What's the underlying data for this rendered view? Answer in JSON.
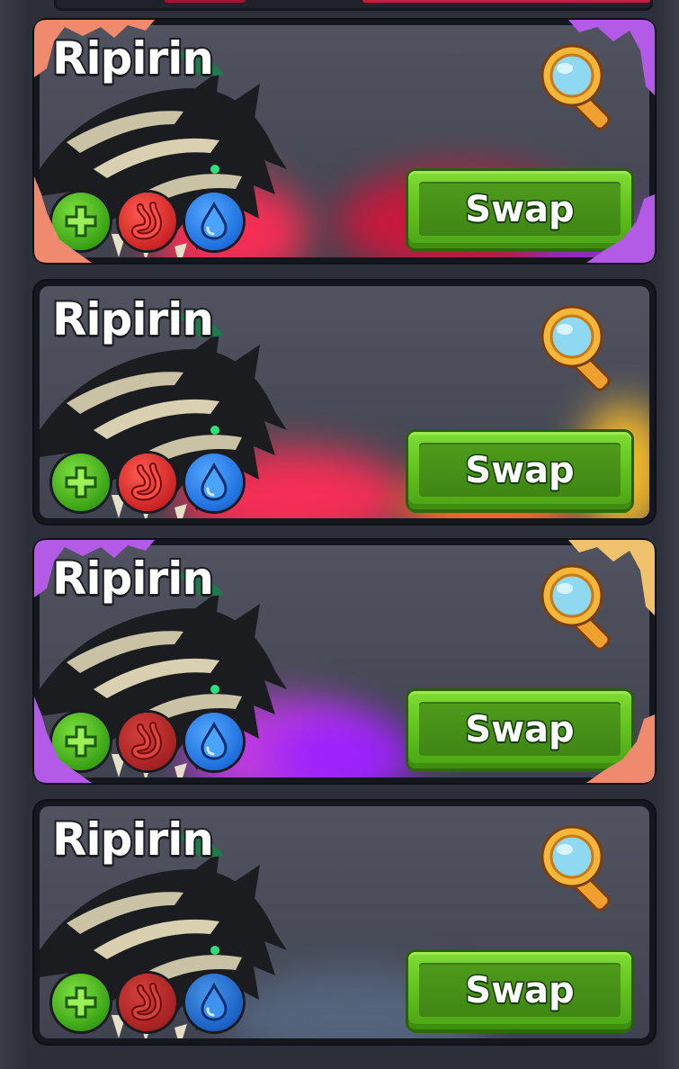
{
  "creature_list": {
    "cards": [
      {
        "name": "Ripirin",
        "swap_label": "Swap",
        "status": [
          "health",
          "hunger",
          "thirst"
        ],
        "frame_colors": [
          "#f08a6e",
          "#b35be6"
        ],
        "glow_colors": [
          "#ff2d55",
          "#a020f0"
        ]
      },
      {
        "name": "Ripirin",
        "swap_label": "Swap",
        "status": [
          "health",
          "hunger",
          "thirst"
        ],
        "frame_colors": [],
        "glow_colors": [
          "#ff2d55",
          "#ffb02a"
        ]
      },
      {
        "name": "Ripirin",
        "swap_label": "Swap",
        "status": [
          "health",
          "hunger",
          "thirst"
        ],
        "frame_colors": [
          "#b35be6",
          "#f0c26e"
        ],
        "glow_colors": [
          "#c33be8",
          "#9b20ff"
        ]
      },
      {
        "name": "Ripirin",
        "swap_label": "Swap",
        "status": [
          "health",
          "hunger",
          "thirst"
        ],
        "frame_colors": [],
        "glow_colors": [
          "#5a6b85",
          "#3c4b63"
        ]
      }
    ]
  },
  "icons": {
    "inspect": "magnifying-glass-icon",
    "health": "plus-icon",
    "hunger": "stomach-icon",
    "thirst": "water-drop-icon"
  }
}
